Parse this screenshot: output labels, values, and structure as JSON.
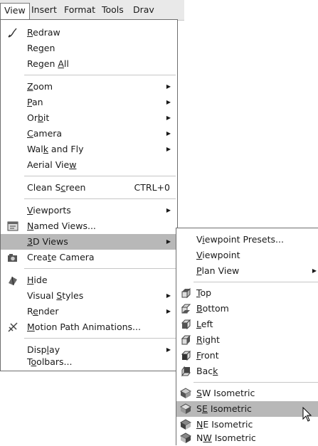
{
  "menubar": {
    "items": [
      {
        "label": "View",
        "active": true
      },
      {
        "label": "Insert"
      },
      {
        "label": "Format"
      },
      {
        "label": "Tools"
      },
      {
        "label": "Drav"
      }
    ]
  },
  "view_menu": {
    "items": [
      {
        "pre": "",
        "u": "R",
        "post": "edraw",
        "icon": "redraw-icon"
      },
      {
        "pre": "Re",
        "u": "g",
        "post": "en"
      },
      {
        "pre": "Regen ",
        "u": "A",
        "post": "ll"
      },
      {
        "pre": "",
        "u": "Z",
        "post": "oom",
        "submenu": true
      },
      {
        "pre": "",
        "u": "P",
        "post": "an",
        "submenu": true
      },
      {
        "pre": "Or",
        "u": "b",
        "post": "it",
        "submenu": true
      },
      {
        "pre": "",
        "u": "C",
        "post": "amera",
        "submenu": true
      },
      {
        "pre": "Wal",
        "u": "k",
        "post": " and Fly",
        "submenu": true
      },
      {
        "pre": "Aerial Vie",
        "u": "w",
        "post": ""
      },
      {
        "pre": "Clean S",
        "u": "c",
        "post": "reen",
        "shortcut": "CTRL+0"
      },
      {
        "pre": "",
        "u": "V",
        "post": "iewports",
        "submenu": true
      },
      {
        "pre": "",
        "u": "N",
        "post": "amed Views...",
        "icon": "named-views-icon"
      },
      {
        "pre": "",
        "u": "3",
        "post": "D Views",
        "submenu": true,
        "highlighted": true
      },
      {
        "pre": "Crea",
        "u": "t",
        "post": "e Camera",
        "icon": "camera-icon"
      },
      {
        "pre": "",
        "u": "H",
        "post": "ide",
        "icon": "hide-icon"
      },
      {
        "pre": "Visual ",
        "u": "S",
        "post": "tyles",
        "submenu": true
      },
      {
        "pre": "R",
        "u": "e",
        "post": "nder",
        "submenu": true
      },
      {
        "pre": "",
        "u": "M",
        "post": "otion Path Animations...",
        "icon": "motion-path-icon"
      },
      {
        "pre": "Disp",
        "u": "l",
        "post": "ay",
        "submenu": true
      },
      {
        "pre": "T",
        "u": "o",
        "post": "olbars..."
      }
    ]
  },
  "views_submenu": {
    "items": [
      {
        "pre": "V",
        "u": "i",
        "post": "ewpoint Presets..."
      },
      {
        "pre": "",
        "u": "V",
        "post": "iewpoint"
      },
      {
        "pre": "",
        "u": "P",
        "post": "lan View",
        "submenu": true
      },
      {
        "pre": "",
        "u": "T",
        "post": "op",
        "icon": "top-view-icon"
      },
      {
        "pre": "",
        "u": "B",
        "post": "ottom",
        "icon": "bottom-view-icon"
      },
      {
        "pre": "",
        "u": "L",
        "post": "eft",
        "icon": "left-view-icon"
      },
      {
        "pre": "",
        "u": "R",
        "post": "ight",
        "icon": "right-view-icon"
      },
      {
        "pre": "",
        "u": "F",
        "post": "ront",
        "icon": "front-view-icon"
      },
      {
        "pre": "Bac",
        "u": "k",
        "post": "",
        "icon": "back-view-icon"
      },
      {
        "pre": "",
        "u": "S",
        "post": "W Isometric",
        "icon": "sw-isometric-icon"
      },
      {
        "pre": "S",
        "u": "E",
        "post": " Isometric",
        "icon": "se-isometric-icon",
        "highlighted": true
      },
      {
        "pre": "",
        "u": "N",
        "post": "E Isometric",
        "icon": "ne-isometric-icon"
      },
      {
        "pre": "N",
        "u": "W",
        "post": " Isometric",
        "icon": "nw-isometric-icon"
      }
    ]
  },
  "colors": {
    "highlight": "#b8b8b8",
    "border": "#6e6e6e",
    "menubar": "#e9e9e9"
  }
}
